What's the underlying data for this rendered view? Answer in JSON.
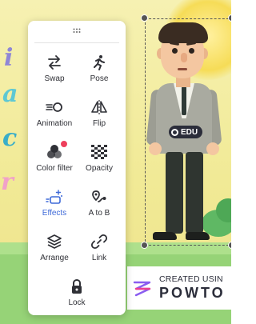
{
  "toolbar": {
    "items": [
      {
        "id": "swap",
        "label": "Swap",
        "icon": "swap-arrows-icon"
      },
      {
        "id": "pose",
        "label": "Pose",
        "icon": "running-figure-icon"
      },
      {
        "id": "animation",
        "label": "Animation",
        "icon": "animation-icon"
      },
      {
        "id": "flip",
        "label": "Flip",
        "icon": "flip-icon"
      },
      {
        "id": "color-filter",
        "label": "Color filter",
        "icon": "color-filter-icon",
        "has_premium_badge": true
      },
      {
        "id": "opacity",
        "label": "Opacity",
        "icon": "opacity-checker-icon"
      },
      {
        "id": "effects",
        "label": "Effects",
        "icon": "effects-sparkle-icon",
        "active": true
      },
      {
        "id": "a-to-b",
        "label": "A to B",
        "icon": "path-pin-icon"
      },
      {
        "id": "arrange",
        "label": "Arrange",
        "icon": "layers-icon"
      },
      {
        "id": "link",
        "label": "Link",
        "icon": "link-icon"
      },
      {
        "id": "lock",
        "label": "Lock",
        "icon": "lock-icon"
      }
    ]
  },
  "character": {
    "badge_label": "EDU"
  },
  "watermark": {
    "line1": "CREATED USIN",
    "brand": "POWTO"
  },
  "colors": {
    "accent": "#3f6ad8",
    "premium_badge": "#ee3f5c",
    "menu_text": "#2f3036",
    "canvas_bg": "#f1ea96",
    "grass": "#96d377"
  }
}
